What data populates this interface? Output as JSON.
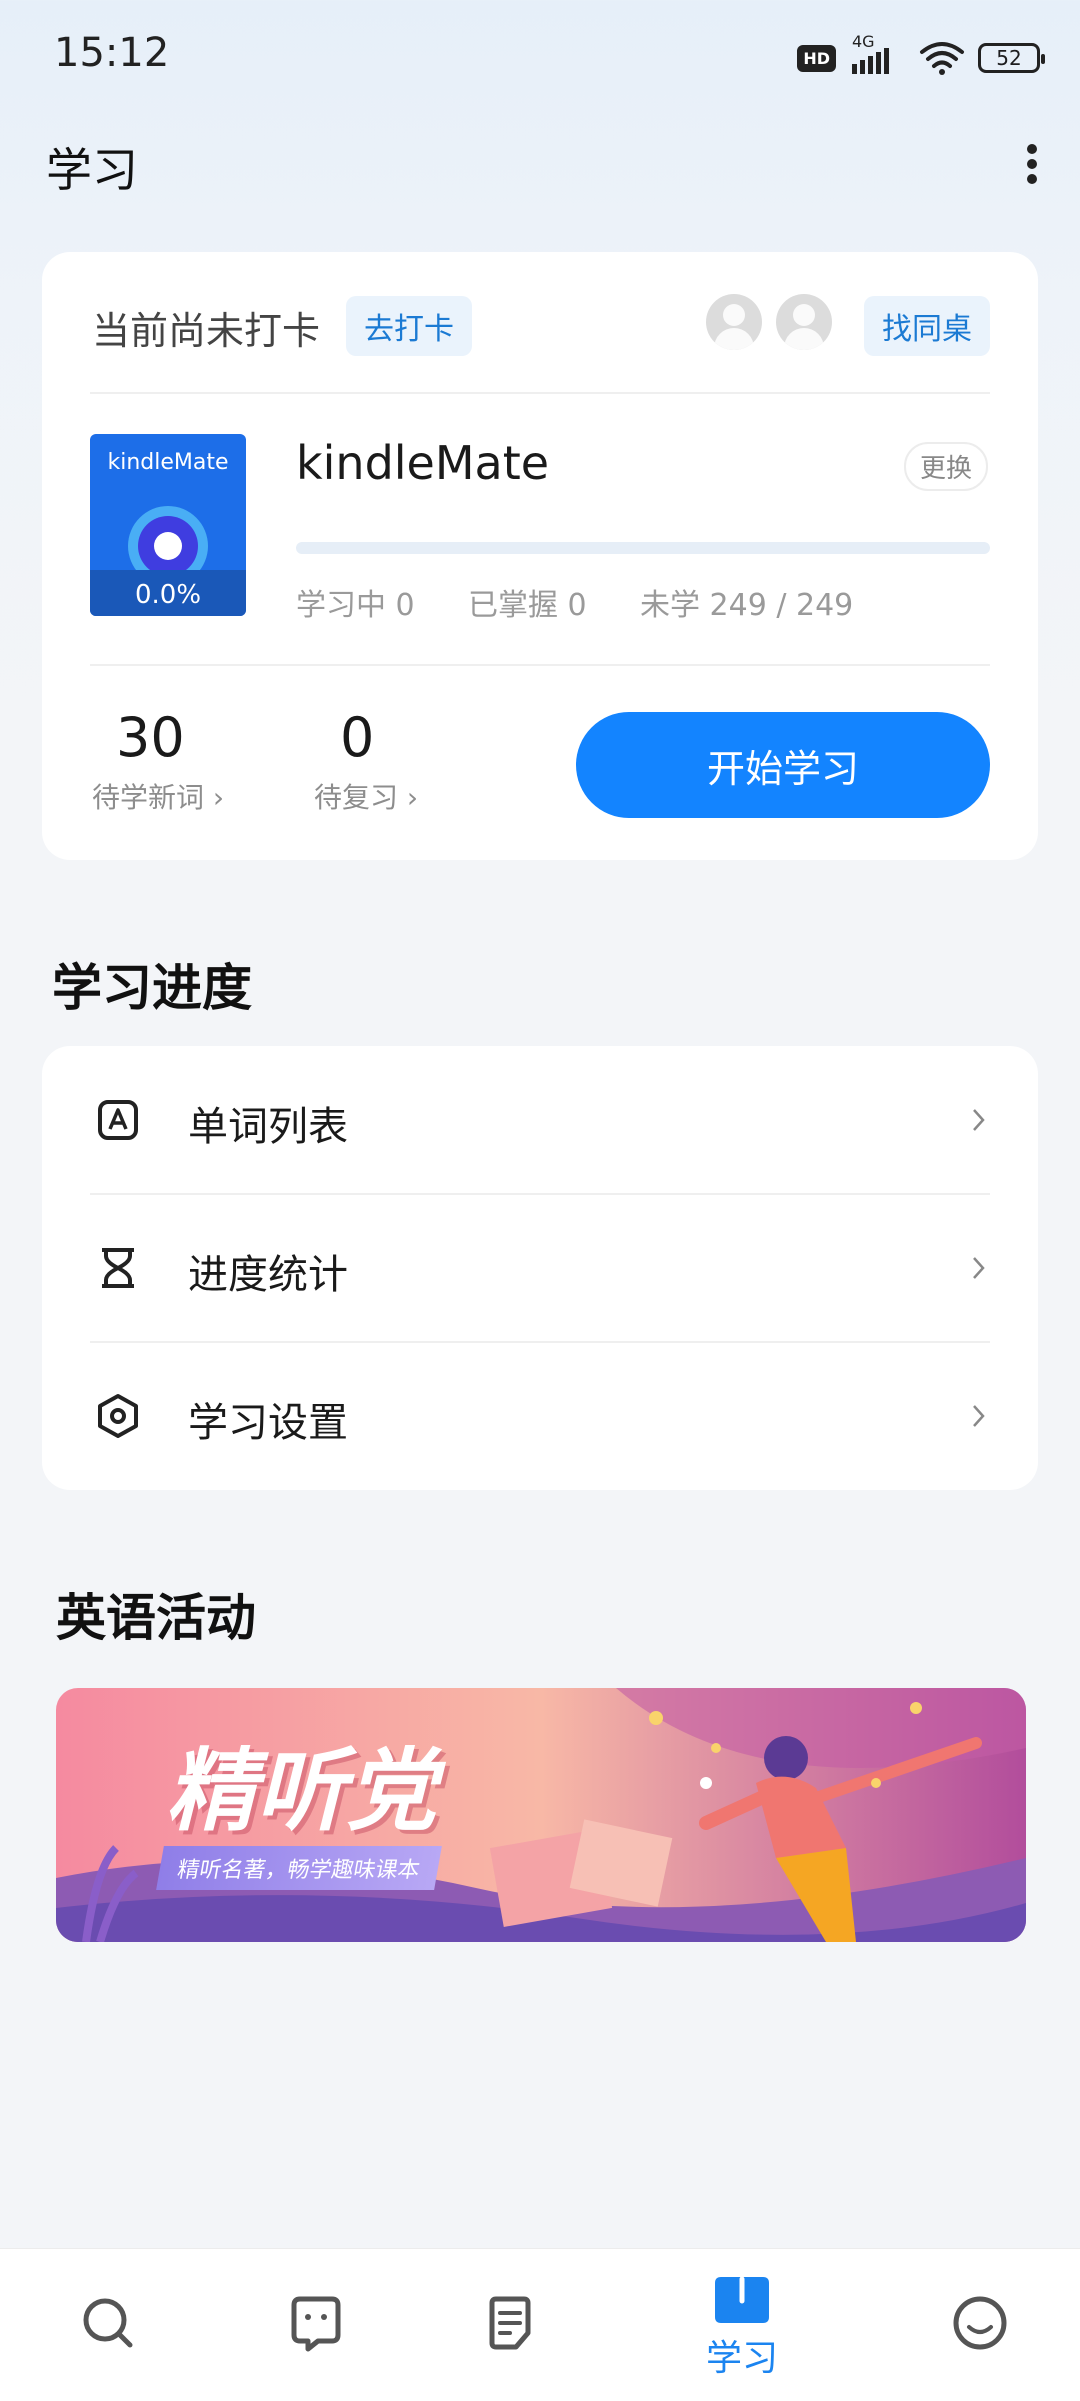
{
  "status_bar": {
    "time": "15:12",
    "hd_badge": "HD",
    "network": "4G",
    "battery": "52"
  },
  "header": {
    "title": "学习"
  },
  "checkin": {
    "status_text": "当前尚未打卡",
    "checkin_button": "去打卡",
    "find_partner_button": "找同桌"
  },
  "book": {
    "cover_title": "kindleMate",
    "cover_percent": "0.0%",
    "title": "kindleMate",
    "change_button": "更换",
    "progress_fraction": 0.0,
    "stats": {
      "learning": "学习中 0",
      "mastered": "已掌握 0",
      "unlearned": "未学 249 / 249"
    }
  },
  "counts": {
    "new_words_value": "30",
    "new_words_label": "待学新词 ›",
    "review_value": "0",
    "review_label": "待复习 ›"
  },
  "start_button": "开始学习",
  "progress_section": {
    "title": "学习进度",
    "items": [
      {
        "label": "单词列表",
        "icon": "word-list-icon"
      },
      {
        "label": "进度统计",
        "icon": "hourglass-icon"
      },
      {
        "label": "学习设置",
        "icon": "settings-icon"
      }
    ]
  },
  "activity_section": {
    "title": "英语活动",
    "banner_title": "精听党",
    "banner_subtitle": "精听名著，畅学趣味课本"
  },
  "bottom_nav": {
    "items": [
      {
        "icon": "search-icon",
        "label": ""
      },
      {
        "icon": "chat-icon",
        "label": ""
      },
      {
        "icon": "document-icon",
        "label": ""
      },
      {
        "icon": "book-icon",
        "label": "学习"
      },
      {
        "icon": "smile-icon",
        "label": ""
      }
    ],
    "active_index": 3,
    "active_color": "#1b84f0"
  },
  "colors": {
    "accent": "#1384ff",
    "link": "#1b7ad3"
  }
}
